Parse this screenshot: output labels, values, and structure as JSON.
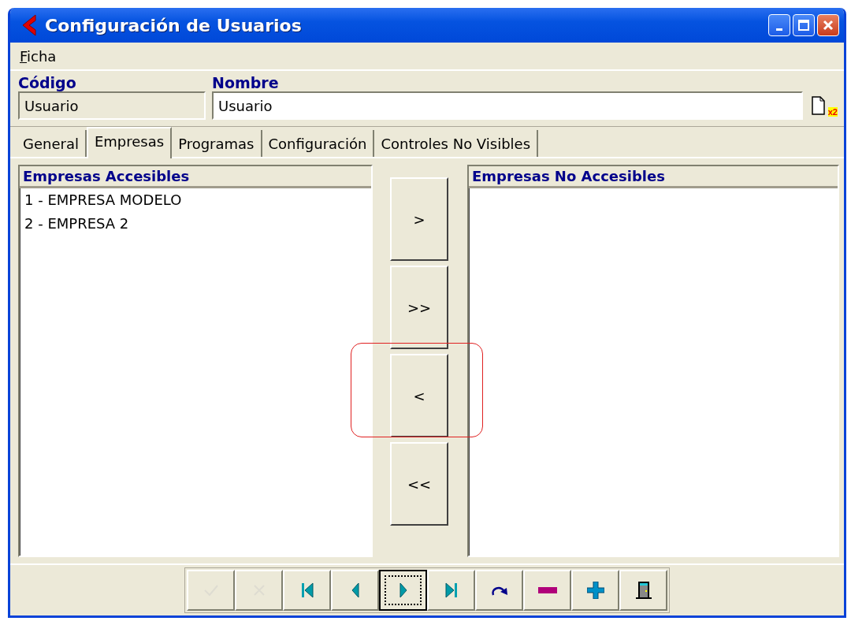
{
  "window": {
    "title": "Configuración de Usuarios"
  },
  "menu": [
    {
      "label": "Ficha"
    }
  ],
  "header": {
    "codigo": {
      "label": "Código",
      "value": "Usuario",
      "disabled": true
    },
    "nombre": {
      "label": "Nombre",
      "value": "Usuario",
      "disabled": false
    },
    "copy_badge": "x2"
  },
  "tabs": [
    {
      "label": "General",
      "selected": false
    },
    {
      "label": "Empresas",
      "selected": true
    },
    {
      "label": "Programas",
      "selected": false
    },
    {
      "label": "Configuración",
      "selected": false
    },
    {
      "label": "Controles No Visibles",
      "selected": false
    }
  ],
  "accessible": {
    "title": "Empresas Accesibles",
    "items": [
      "1 - EMPRESA MODELO",
      "2 - EMPRESA 2"
    ]
  },
  "transfer_buttons": [
    {
      "label": ">",
      "highlighted": false
    },
    {
      "label": ">>",
      "highlighted": false
    },
    {
      "label": "<",
      "highlighted": true
    },
    {
      "label": "<<",
      "highlighted": false
    }
  ],
  "not_accessible": {
    "title": "Empresas No Accesibles"
  },
  "toolbar": [
    {
      "kind": "confirm",
      "disabled": true,
      "focused": false
    },
    {
      "kind": "cancel",
      "disabled": true,
      "focused": false
    },
    {
      "kind": "first",
      "disabled": false,
      "focused": false
    },
    {
      "kind": "previous",
      "disabled": false,
      "focused": false
    },
    {
      "kind": "next",
      "disabled": false,
      "focused": true
    },
    {
      "kind": "last",
      "disabled": false,
      "focused": false
    },
    {
      "kind": "refresh",
      "disabled": false,
      "focused": false
    },
    {
      "kind": "delete",
      "disabled": false,
      "focused": false
    },
    {
      "kind": "add",
      "disabled": false,
      "focused": false
    },
    {
      "kind": "exit",
      "disabled": false,
      "focused": false
    }
  ]
}
